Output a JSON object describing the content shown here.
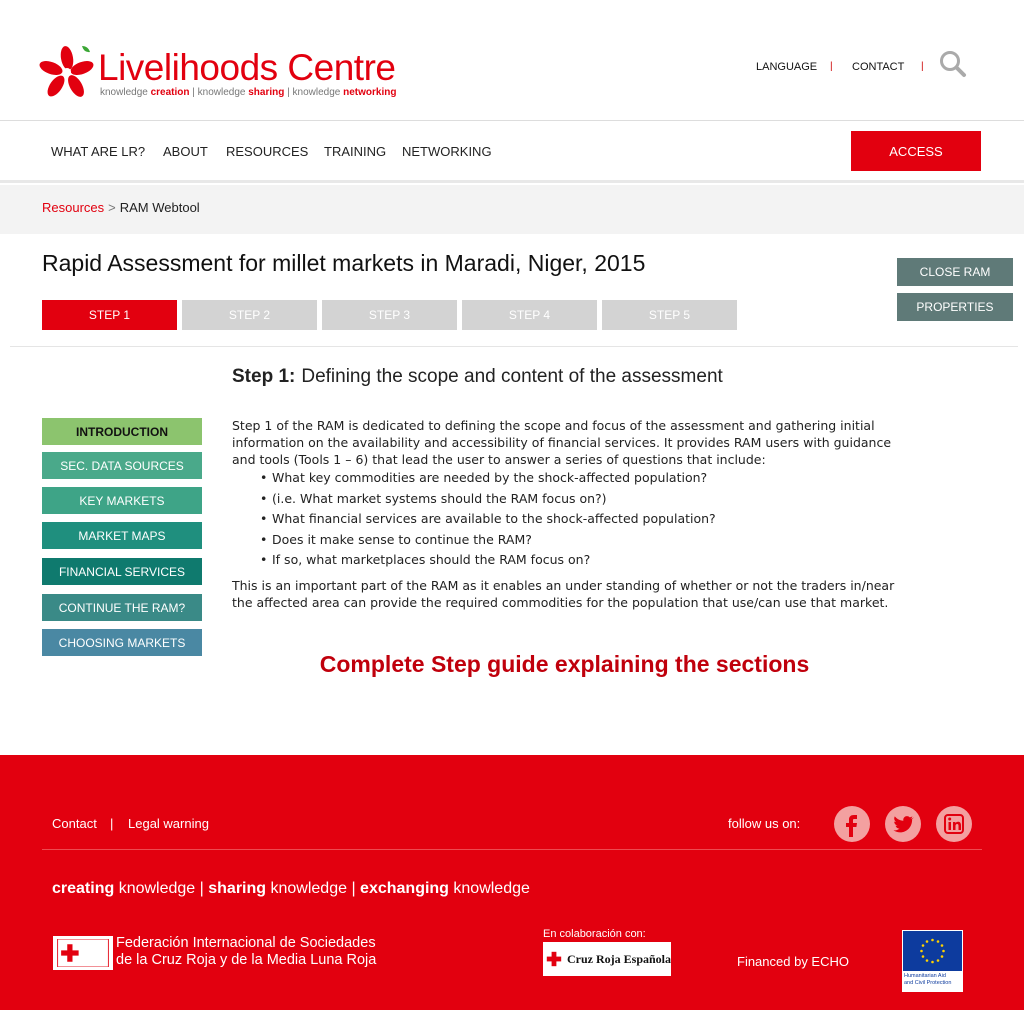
{
  "header": {
    "logo": {
      "title_part1": "Live",
      "title_part2": "lihoods Centre",
      "sub_knowledge1": "knowledge ",
      "sub_creation": "creation",
      "sub_knowledge2": " | knowledge ",
      "sub_sharing": "sharing",
      "sub_knowledge3": " | knowledge ",
      "sub_networking": "networking"
    },
    "language_label": "LANGUAGE",
    "contact_label": "CONTACT",
    "separator": "|"
  },
  "nav": {
    "items": [
      "WHAT ARE LR?",
      "ABOUT",
      "RESOURCES",
      "TRAINING",
      "NETWORKING"
    ],
    "access_label": "ACCESS"
  },
  "breadcrumb": {
    "link": "Resources",
    "separator": ">",
    "current": "RAM Webtool"
  },
  "page": {
    "title": "Rapid Assessment for millet markets in Maradi, Niger, 2015",
    "close_label": "CLOSE RAM",
    "properties_label": "PROPERTIES",
    "steps": [
      "STEP 1",
      "STEP 2",
      "STEP 3",
      "STEP 4",
      "STEP 5"
    ],
    "active_step": 0
  },
  "content": {
    "heading_bold": "Step 1:",
    "heading_rest": "Defining the scope and content of the assessment",
    "menu": [
      {
        "label": "INTRODUCTION",
        "color": "#8cc46e",
        "text_color": "#111111"
      },
      {
        "label": "SEC. DATA SOURCES",
        "color": "#4aa98a",
        "text_color": "#ffffff"
      },
      {
        "label": "KEY MARKETS",
        "color": "#3ea487",
        "text_color": "#ffffff"
      },
      {
        "label": "MARKET MAPS",
        "color": "#1f8f7e",
        "text_color": "#ffffff"
      },
      {
        "label": "FINANCIAL SERVICES",
        "color": "#0f7a6e",
        "text_color": "#ffffff"
      },
      {
        "label": "CONTINUE THE RAM?",
        "color": "#3a8a87",
        "text_color": "#ffffff"
      },
      {
        "label": "CHOOSING MARKETS",
        "color": "#4a88a3",
        "text_color": "#ffffff"
      }
    ],
    "intro": "Step 1 of the RAM is dedicated to defining the scope and focus of the assessment and gathering initial information on the availability and accessibility of financial services. It provides RAM users with guidance and tools (Tools 1 – 6) that lead the user to answer a series of questions that include:",
    "bullets": [
      "What key commodities are needed by the shock-affected population?",
      "(i.e. What market systems should the RAM focus on?)",
      "What financial services are available to the shock-affected population?",
      "Does it make sense to continue the RAM?",
      "If so, what marketplaces should the RAM focus on?"
    ],
    "closing": "This is an important part of the RAM as it enables an under standing of whether or not the traders in/near the affected area can provide the required commodities for the population that use/can use that market.",
    "guide_link": "Complete Step guide explaining the sections"
  },
  "footer": {
    "contact": "Contact",
    "separator": "|",
    "legal": "Legal warning",
    "follow": "follow us on:",
    "social": [
      "facebook-icon",
      "twitter-icon",
      "linkedin-icon"
    ],
    "tag_creating": "creating",
    "tag_knowledge1": " knowledge | ",
    "tag_sharing": "sharing",
    "tag_knowledge2": " knowledge | ",
    "tag_exchanging": "exchanging",
    "tag_knowledge3": " knowledge",
    "ifrc_line1": "Federación Internacional de Sociedades",
    "ifrc_line2": "de la Cruz Roja y de la Media Luna Roja",
    "colab": "En colaboración con:",
    "cruz_roja": "Cruz Roja Española",
    "echo": "Financed by ECHO",
    "eu_line1": "Humanitarian Aid",
    "eu_line2": "and Civil Protection",
    "brand_red": "#e2000f"
  }
}
